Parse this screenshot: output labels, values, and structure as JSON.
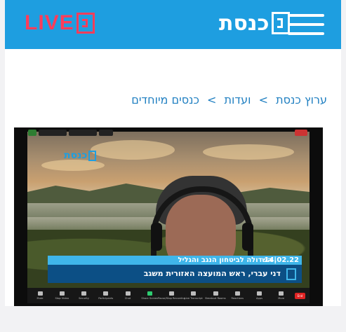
{
  "header": {
    "live_label": "LIVE",
    "knesset_label": "כנסת",
    "menu_icon": "hamburger-icon",
    "brand_color": "#1e9ee0",
    "live_color": "#ff3d5a"
  },
  "breadcrumb": {
    "items": [
      "ערוץ כנסת",
      "ועדות",
      "כנסים מיוחדים"
    ],
    "separator": ">"
  },
  "video": {
    "watermark": "כנסת",
    "lower_third": {
      "date": "14.02.22",
      "committee": "השדולה לביטחון הנגב והגליל",
      "speaker": "דני עברי, ראש המועצה האזורית משגב"
    },
    "toolbar": {
      "items": [
        "Mute",
        "Stop Video",
        "Security",
        "Participants",
        "Chat",
        "Share Screen",
        "Pause/Stop Recording",
        "Live Transcript",
        "Breakout Rooms",
        "Reactions",
        "Apps",
        "More"
      ],
      "end_label": "End"
    }
  }
}
